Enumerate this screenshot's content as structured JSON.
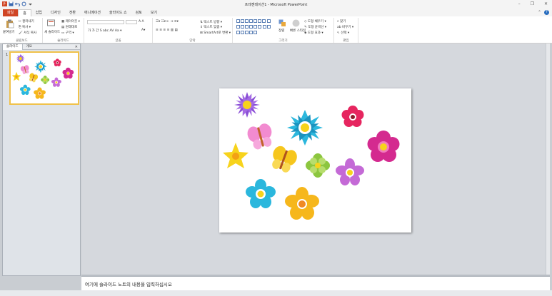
{
  "window": {
    "title": "프레젠테이션1 - Microsoft PowerPoint",
    "controls": [
      "–",
      "❐",
      "✕"
    ]
  },
  "qat": {
    "items": [
      "save-icon",
      "undo-icon",
      "redo-icon",
      "customize-icon"
    ]
  },
  "tabs": [
    {
      "label": "파일"
    },
    {
      "label": "홈"
    },
    {
      "label": "삽입"
    },
    {
      "label": "디자인"
    },
    {
      "label": "전환"
    },
    {
      "label": "애니메이션"
    },
    {
      "label": "슬라이드 쇼"
    },
    {
      "label": "검토"
    },
    {
      "label": "보기"
    }
  ],
  "ribbon": {
    "clipboard": {
      "paste": "붙여넣기",
      "cut": "잘라내기",
      "copy": "복사",
      "format_painter": "서식 복사",
      "label": "클립보드"
    },
    "slides": {
      "new_slide": "새 슬라이드",
      "layout": "레이아웃",
      "reset": "원래대로",
      "section": "구역",
      "label": "슬라이드"
    },
    "font": {
      "label": "글꼴"
    },
    "paragraph": {
      "text_direction": "텍스트 방향",
      "align_text": "텍스트 맞춤",
      "smartart": "SmartArt로 변환",
      "label": "단락"
    },
    "drawing": {
      "arrange": "정렬",
      "quick_styles": "빠른 스타일",
      "shape_fill": "도형 채우기",
      "shape_outline": "도형 윤곽선",
      "shape_effects": "도형 효과",
      "label": "그리기"
    },
    "editing": {
      "find": "찾기",
      "replace": "바꾸기",
      "select": "선택",
      "label": "편집"
    }
  },
  "left_pane": {
    "tabs": [
      "슬라이드",
      "개요"
    ],
    "close": "✕",
    "slide_number": "1"
  },
  "notes": {
    "placeholder": "여기에 슬라이드 노트의 내용을 입력하십시오"
  },
  "colors": {
    "file_tab": "#d04525",
    "purple": "#8a4fd6",
    "cyan": "#2bb7dd",
    "pink": "#e63a8a",
    "magenta": "#d42a8f",
    "yellow": "#f7d31c",
    "green": "#8cc63f",
    "orange": "#f6a91c"
  }
}
